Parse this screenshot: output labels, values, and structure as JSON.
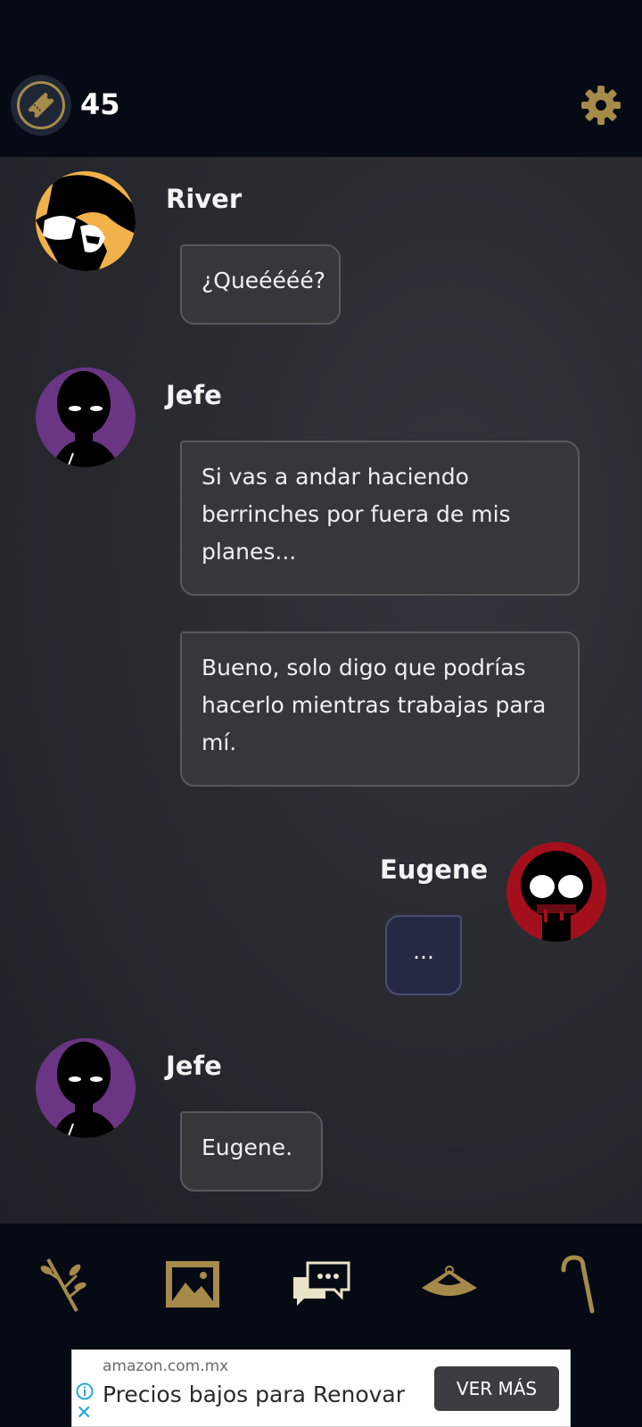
{
  "header": {
    "ticket_icon": "ticket-icon",
    "ticket_count": "45",
    "settings_icon": "gear-icon"
  },
  "messages": [
    {
      "sender": "River",
      "text": [
        "¿Queéééé?"
      ],
      "avatar_color": "#f2b14a"
    },
    {
      "sender": "Jefe",
      "text": [
        "Si vas a andar haciendo",
        "berrinches por fuera de mis",
        "planes..."
      ],
      "avatar_color": "#6a3582"
    },
    {
      "sender": "Jefe",
      "text": [
        "Bueno, solo digo que podrías",
        "hacerlo mientras trabajas para",
        "mí."
      ]
    },
    {
      "sender": "Eugene",
      "text": [
        "..."
      ],
      "avatar_color": "#a3101b"
    },
    {
      "sender": "Jefe",
      "text": [
        "Eugene."
      ],
      "avatar_color": "#6a3582"
    }
  ],
  "bottom_nav": [
    {
      "icon": "branch-icon"
    },
    {
      "icon": "gallery-icon"
    },
    {
      "icon": "chat-icon"
    },
    {
      "icon": "hat-icon"
    },
    {
      "icon": "cane-icon"
    }
  ],
  "ad": {
    "domain": "amazon.com.mx",
    "title": "Precios bajos para Renovar",
    "cta": "VER MÁS"
  },
  "colors": {
    "accent_gold": "#a68a4a",
    "bubble_bg": "#37373a",
    "player_bubble_bg": "#252943"
  }
}
